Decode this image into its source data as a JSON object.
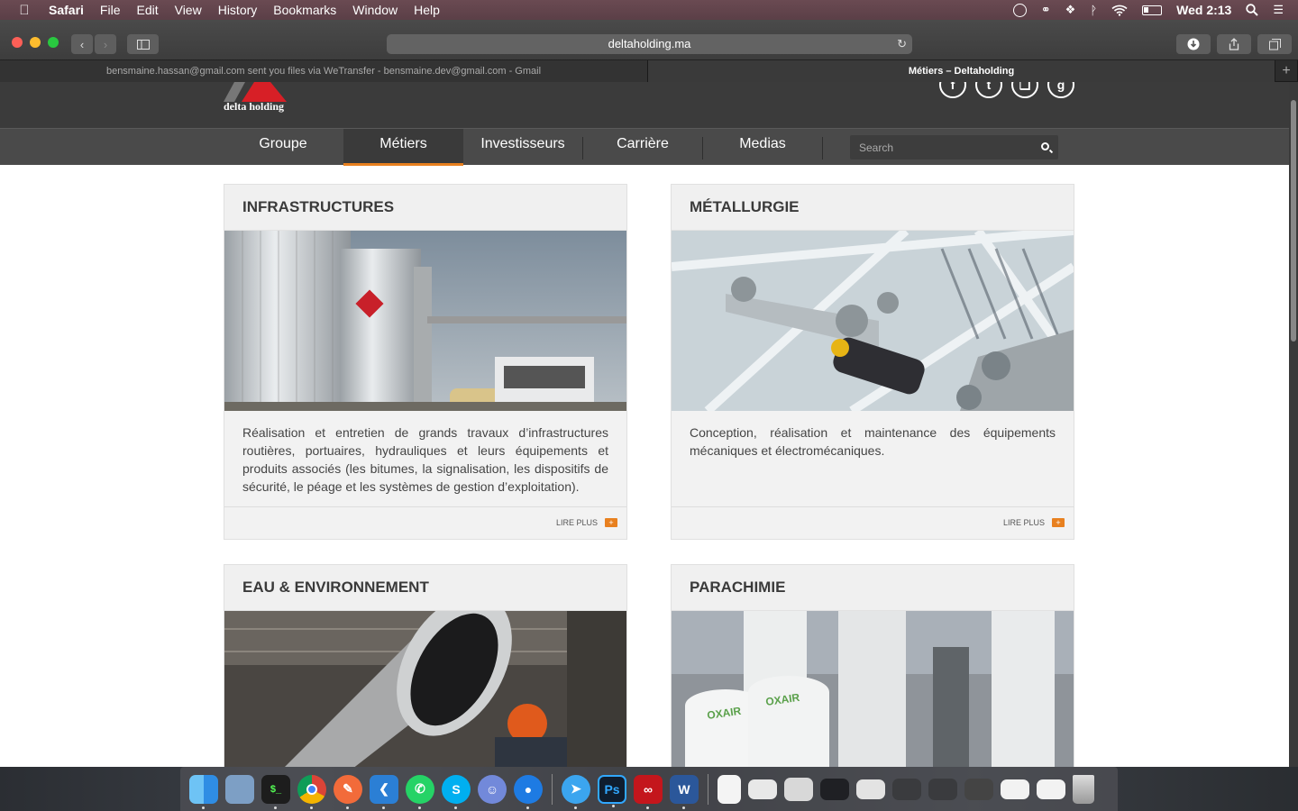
{
  "menubar": {
    "app": "Safari",
    "items": [
      "File",
      "Edit",
      "View",
      "History",
      "Bookmarks",
      "Window",
      "Help"
    ],
    "clock": "Wed 2:13"
  },
  "browser": {
    "url": "deltaholding.ma",
    "tabs": [
      {
        "title": "bensmaine.hassan@gmail.com sent you files via WeTransfer - bensmaine.dev@gmail.com - Gmail",
        "active": false
      },
      {
        "title": "Métiers – Deltaholding",
        "active": true
      }
    ]
  },
  "site": {
    "logo_text": "delta holding",
    "social": [
      "f",
      "t",
      "rss",
      "g+"
    ],
    "nav": [
      "Groupe",
      "Métiers",
      "Investisseurs",
      "Carrière",
      "Medias"
    ],
    "active_nav": "Métiers",
    "search_placeholder": "Search",
    "accent": "#e8801f"
  },
  "cards": [
    {
      "title": "INFRASTRUCTURES",
      "image": "fuel-tanks-and-truck",
      "text": "Réalisation et entretien de grands travaux d’infrastructures routières, portuaires, hydrauliques et leurs équipements et produits associés (les bitumes, la signalisation, les dispositifs de sécurité, le péage et les systèmes de gestion d’exploitation).",
      "more": "LIRE PLUS"
    },
    {
      "title": "MÉTALLURGIE",
      "image": "steel-structure-worker",
      "text": "Conception, réalisation et maintenance des équipements mécaniques et électromécaniques.",
      "more": "LIRE PLUS"
    },
    {
      "title": "EAU & ENVIRONNEMENT",
      "image": "pipe-factory-worker",
      "text": "",
      "more": ""
    },
    {
      "title": "PARACHIMIE",
      "image": "oxair-gas-tanks",
      "text": "",
      "more": ""
    }
  ]
}
